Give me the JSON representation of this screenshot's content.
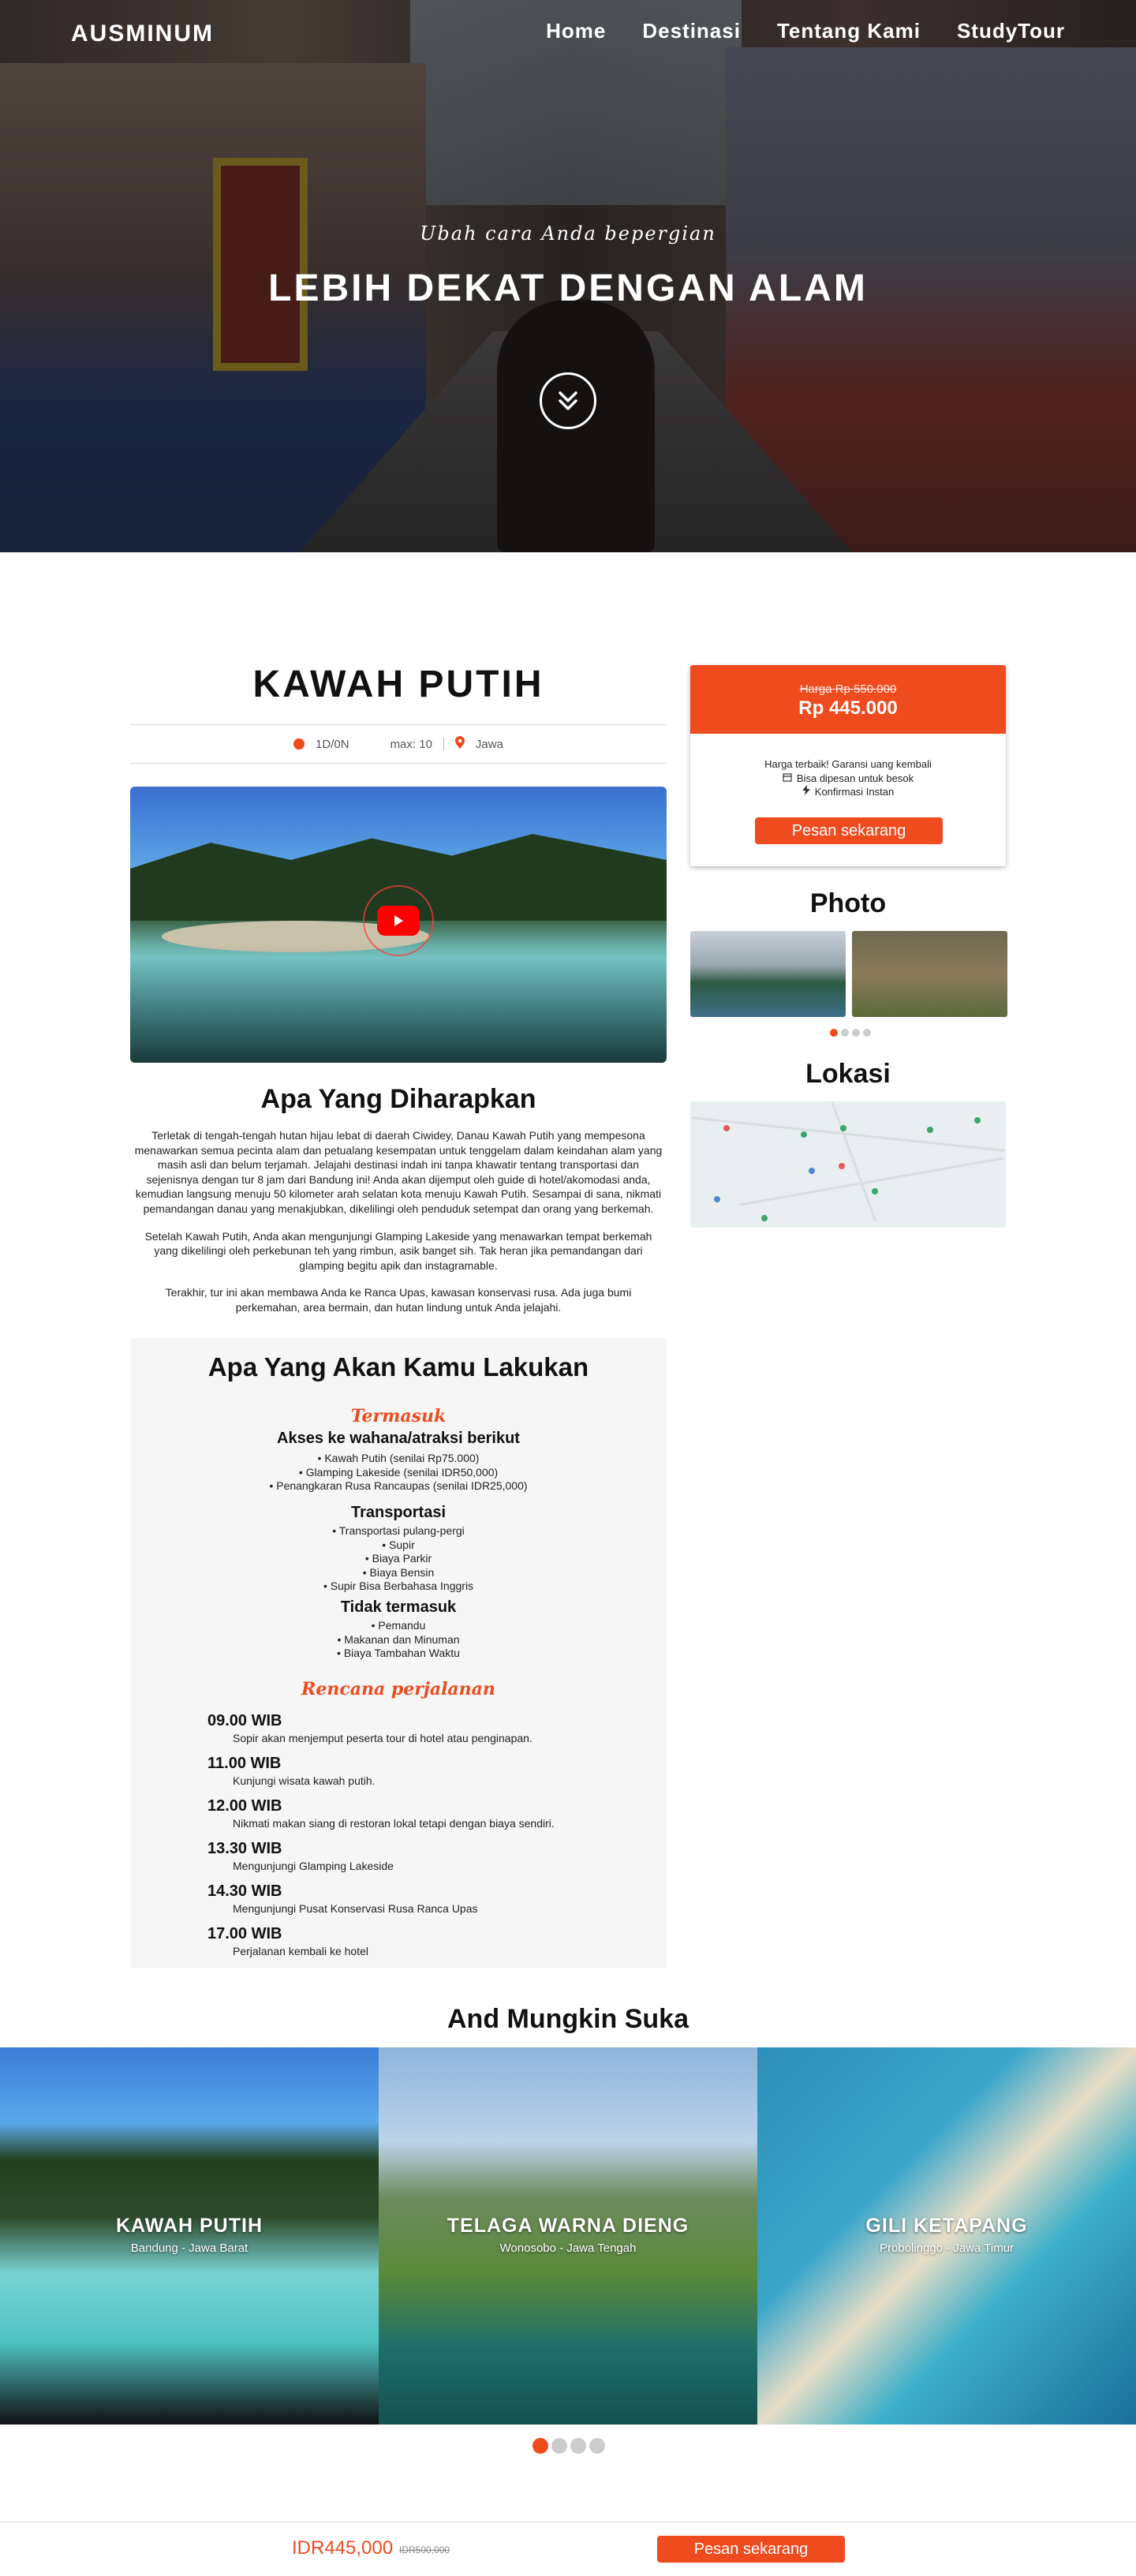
{
  "nav": {
    "logo": "AUSMINUM",
    "links": [
      "Home",
      "Destinasi",
      "Tentang Kami",
      "StudyTour"
    ]
  },
  "hero": {
    "subtitle": "Ubah cara Anda bepergian",
    "title": "LEBIH DEKAT DENGAN ALAM",
    "scroll_icon": "double-chevron-down-icon"
  },
  "tour": {
    "title": "KAWAH PUTIH",
    "duration": "1D/0N",
    "max": "max: 10",
    "region": "Jawa"
  },
  "expect": {
    "heading": "Apa Yang Diharapkan",
    "paragraphs": [
      "Terletak di tengah-tengah hutan hijau lebat di daerah Ciwidey, Danau Kawah Putih yang mempesona menawarkan semua pecinta alam dan petualang kesempatan untuk tenggelam dalam keindahan alam yang masih asli dan belum terjamah. Jelajahi destinasi indah ini tanpa khawatir tentang transportasi dan sejenisnya dengan tur 8 jam dari Bandung ini! Anda akan dijemput oleh guide di hotel/akomodasi anda, kemudian langsung menuju 50 kilometer arah selatan kota menuju Kawah Putih. Sesampai di sana, nikmati pemandangan danau yang menakjubkan, dikelilingi oleh penduduk setempat dan orang yang berkemah.",
      "Setelah Kawah Putih, Anda akan mengunjungi Glamping Lakeside yang menawarkan tempat berkemah yang dikelilingi oleh perkebunan teh yang rimbun, asik banget sih. Tak heran jika pemandangan dari glamping begitu apik dan instagramable.",
      "Terakhir, tur ini akan membawa Anda ke Ranca Upas, kawasan konservasi rusa. Ada juga bumi perkemahan, area bermain, dan hutan lindung untuk Anda jelajahi."
    ]
  },
  "todo": {
    "heading": "Apa Yang Akan Kamu Lakukan",
    "included_heading": "Termasuk",
    "groups": [
      {
        "title": "Akses ke wahana/atraksi berikut",
        "items": [
          "Kawah Putih (senilai Rp75.000)",
          "Glamping Lakeside (senilai IDR50,000)",
          "Penangkaran Rusa Rancaupas (senilai IDR25,000)"
        ]
      },
      {
        "title": "Transportasi",
        "items": [
          "Transportasi pulang-pergi",
          "Supir",
          "Biaya Parkir",
          "Biaya Bensin",
          "Supir Bisa Berbahasa Inggris"
        ]
      },
      {
        "title": "Tidak termasuk",
        "items": [
          "Pemandu",
          "Makanan dan Minuman",
          "Biaya Tambahan Waktu"
        ]
      }
    ],
    "itinerary_heading": "Rencana perjalanan",
    "itinerary": [
      {
        "time": "09.00 WIB",
        "desc": "Sopir akan menjemput peserta tour di hotel atau penginapan."
      },
      {
        "time": "11.00 WIB",
        "desc": "Kunjungi wisata kawah putih."
      },
      {
        "time": "12.00 WIB",
        "desc": "Nikmati makan siang di restoran lokal tetapi dengan biaya sendiri."
      },
      {
        "time": "13.30 WIB",
        "desc": "Mengunjungi Glamping Lakeside"
      },
      {
        "time": "14.30 WIB",
        "desc": "Mengunjungi Pusat Konservasi Rusa Ranca Upas"
      },
      {
        "time": "17.00 WIB",
        "desc": "Perjalanan kembali ke hotel"
      }
    ]
  },
  "price": {
    "old_label": "Harga Rp",
    "old_value": "550.000",
    "new_price": "Rp 445.000",
    "guarantee": "Harga terbaik! Garansi uang kembali",
    "feature1": "Bisa dipesan untuk besok",
    "feature2": "Konfirmasi Instan",
    "book_label": "Pesan sekarang"
  },
  "photo": {
    "heading": "Photo"
  },
  "location": {
    "heading": "Lokasi"
  },
  "maybe_like": {
    "heading": "And Mungkin Suka",
    "cards": [
      {
        "title": "KAWAH PUTIH",
        "place": "Bandung - Jawa Barat"
      },
      {
        "title": "TELAGA WARNA DIENG",
        "place": "Wonosobo - Jawa Tengah"
      },
      {
        "title": "GILI KETAPANG",
        "place": "Probolinggo - Jawa Timur"
      }
    ]
  },
  "footer": {
    "price": "IDR445,000",
    "old_price": "IDR500,000",
    "book_label": "Pesan sekarang"
  },
  "colors": {
    "accent": "#ee4b1e"
  }
}
